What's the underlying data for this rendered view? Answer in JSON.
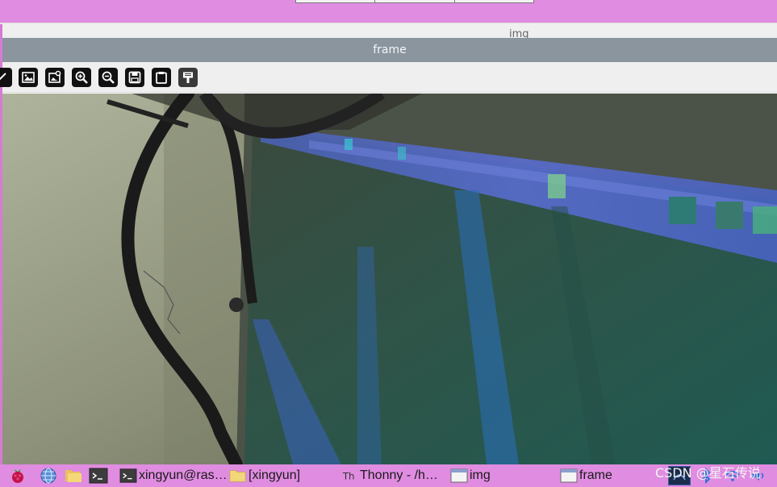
{
  "background_window": {
    "title": "img"
  },
  "window": {
    "title": "frame"
  },
  "toolbar": {
    "buttons": [
      {
        "icon": "pan-icon"
      },
      {
        "icon": "image-icon"
      },
      {
        "icon": "image-settings-icon"
      },
      {
        "icon": "zoom-in-icon"
      },
      {
        "icon": "zoom-out-icon"
      },
      {
        "icon": "save-icon"
      },
      {
        "icon": "clipboard-icon"
      },
      {
        "icon": "properties-icon"
      }
    ]
  },
  "taskbar": {
    "launchers": [
      {
        "icon": "raspberry-menu-icon"
      },
      {
        "icon": "web-browser-icon"
      },
      {
        "icon": "file-manager-icon"
      },
      {
        "icon": "terminal-icon"
      }
    ],
    "tasks": [
      {
        "label": "xingyun@ras…",
        "icon": "terminal-icon"
      },
      {
        "label": "[xingyun]",
        "icon": "folder-icon"
      },
      {
        "label": "Thonny  -  /h…",
        "icon": "thonny-icon"
      },
      {
        "label": "img",
        "icon": "window-icon"
      },
      {
        "label": "frame",
        "icon": "window-icon"
      }
    ],
    "watermark": "CSDN @星石传说"
  },
  "colors": {
    "taskbar": "#e08ce0",
    "titlebar": "#8a959e",
    "toolbar": "#efefef"
  }
}
